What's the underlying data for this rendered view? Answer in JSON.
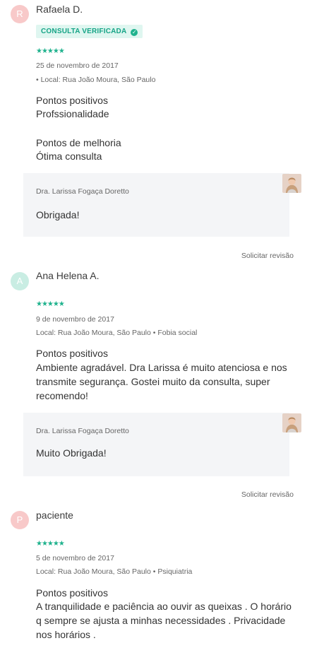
{
  "reviews": [
    {
      "avatar_letter": "R",
      "avatar_color": "#f8c9c9",
      "name": "Rafaela D.",
      "badge": "CONSULTA VERIFICADA",
      "stars": "★★★★★",
      "date": "25 de novembro de 2017",
      "location": "• Local: Rua João Moura, São Paulo",
      "positives_title": "Pontos positivos",
      "positives_text": "Profssionalidade",
      "improvements_title": "Pontos de melhoria",
      "improvements_text": "Ótima consulta",
      "reply_author": "Dra. Larissa Fogaça Doretto",
      "reply_text": "Obrigada!",
      "action": "Solicitar revisão"
    },
    {
      "avatar_letter": "A",
      "avatar_color": "#c9ede3",
      "name": "Ana Helena A.",
      "stars": "★★★★★",
      "date": "9 de novembro de 2017",
      "location": "Local: Rua João Moura, São Paulo • Fobia social",
      "positives_title": "Pontos positivos",
      "positives_text": "Ambiente agradável. Dra Larissa é muito atenciosa e nos transmite segurança. Gostei muito da consulta, super recomendo!",
      "reply_author": "Dra. Larissa Fogaça Doretto",
      "reply_text": "Muito Obrigada!",
      "action": "Solicitar revisão"
    },
    {
      "avatar_letter": "P",
      "avatar_color": "#f8c9c9",
      "name": "paciente",
      "stars": "★★★★★",
      "date": "5 de novembro de 2017",
      "location": "Local: Rua João Moura, São Paulo • Psiquiatria",
      "positives_title": "Pontos positivos",
      "positives_text": "A tranquilidade e paciência ao ouvir as queixas . O horário q sempre se ajusta a minhas necessidades . Privacidade nos horários ."
    }
  ],
  "colors": {
    "accent": "#1fb28d",
    "badge_bg": "#dff6f0",
    "reply_bg": "#f4f5f7"
  }
}
